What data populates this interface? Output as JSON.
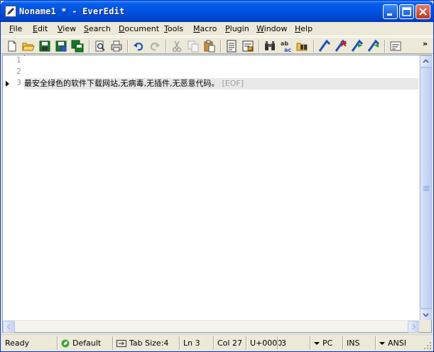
{
  "window": {
    "title": "Noname1 * - EverEdit"
  },
  "menu": [
    {
      "label": "File",
      "mnemonic": "F",
      "rest": "ile"
    },
    {
      "label": "Edit",
      "mnemonic": "E",
      "rest": "dit"
    },
    {
      "label": "View",
      "mnemonic": "V",
      "rest": "iew"
    },
    {
      "label": "Search",
      "mnemonic": "S",
      "rest": "earch"
    },
    {
      "label": "Document",
      "mnemonic": "D",
      "rest": "ocument"
    },
    {
      "label": "Tools",
      "mnemonic": "T",
      "rest": "ools"
    },
    {
      "label": "Macro",
      "mnemonic": "M",
      "rest": "acro"
    },
    {
      "label": "Plugin",
      "mnemonic": "P",
      "rest": "lugin"
    },
    {
      "label": "Window",
      "mnemonic": "W",
      "rest": "indow"
    },
    {
      "label": "Help",
      "mnemonic": "H",
      "rest": "elp"
    }
  ],
  "toolbar": {
    "more": "»"
  },
  "editor": {
    "line_numbers": [
      "1",
      "2",
      "3"
    ],
    "lines": [
      "",
      "",
      "最安全绿色的软件下载网站,无病毒,无插件,无恶意代码。"
    ],
    "eof_marker": "[EOF]",
    "current_line": 3
  },
  "status": {
    "ready": "Ready",
    "scheme": "Default",
    "tab_size": "Tab Size:4",
    "line": "Ln 3",
    "col": "Col 27",
    "unicode": "U+0000",
    "value": "3",
    "line_ending": "PC",
    "mode": "INS",
    "encoding": "ANSI"
  },
  "colors": {
    "titlebar": "#0054e3",
    "chrome": "#ece9d8",
    "current_line": "#e8e8e8",
    "line_number": "#9a9a9a",
    "eof": "#a0a0a0"
  }
}
